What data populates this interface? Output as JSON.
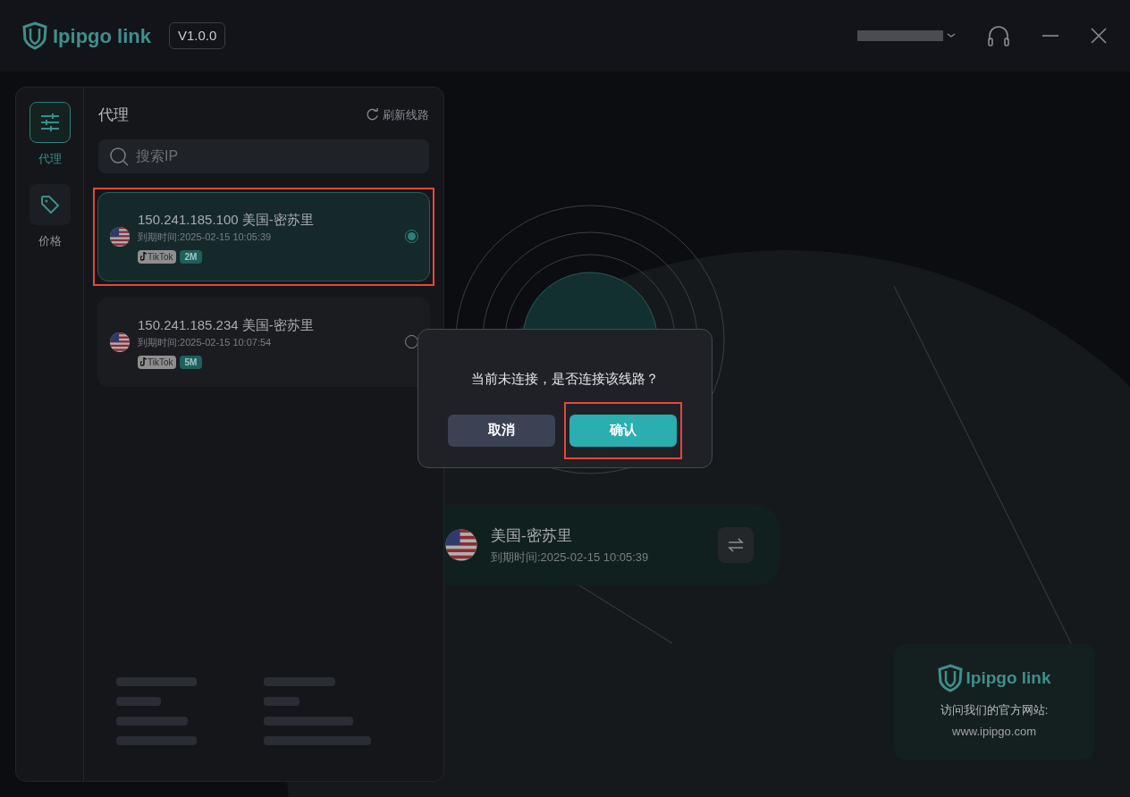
{
  "app": {
    "logo_text": "Ipipgo link",
    "version": "V1.0.0"
  },
  "nav": [
    {
      "label": "代理",
      "kind": "sliders",
      "selected": true
    },
    {
      "label": "价格",
      "kind": "tag",
      "selected": false
    }
  ],
  "proxy_panel": {
    "title": "代理",
    "refresh": "刷新线路",
    "search": {
      "placeholder": "搜索IP"
    },
    "lines": [
      {
        "title": "150.241.185.100 美国-密苏里",
        "expiry": "到期时间:2025-02-15 10:05:39",
        "tags": [
          {
            "label": "TikTok",
            "kind": "app"
          },
          {
            "label": "2M",
            "kind": "bandwidth"
          }
        ],
        "selected": true,
        "highlighted": true
      },
      {
        "title": "150.241.185.234 美国-密苏里",
        "expiry": "到期时间:2025-02-15 10:07:54",
        "tags": [
          {
            "label": "TikTok",
            "kind": "app"
          },
          {
            "label": "5M",
            "kind": "bandwidth"
          }
        ],
        "selected": false,
        "highlighted": false
      }
    ]
  },
  "connection": {
    "region": "美国-密苏里",
    "expiry": "到期时间:2025-02-15 10:05:39"
  },
  "promo": {
    "logo_text": "Ipipgo link",
    "label": "访问我们的官方网站:",
    "url": "www.ipipgo.com"
  },
  "dialog": {
    "message": "当前未连接，是否连接该线路？",
    "buttons": [
      {
        "label": "取消",
        "kind": "cancel",
        "highlighted": false
      },
      {
        "label": "确认",
        "kind": "confirm",
        "highlighted": true
      }
    ]
  }
}
